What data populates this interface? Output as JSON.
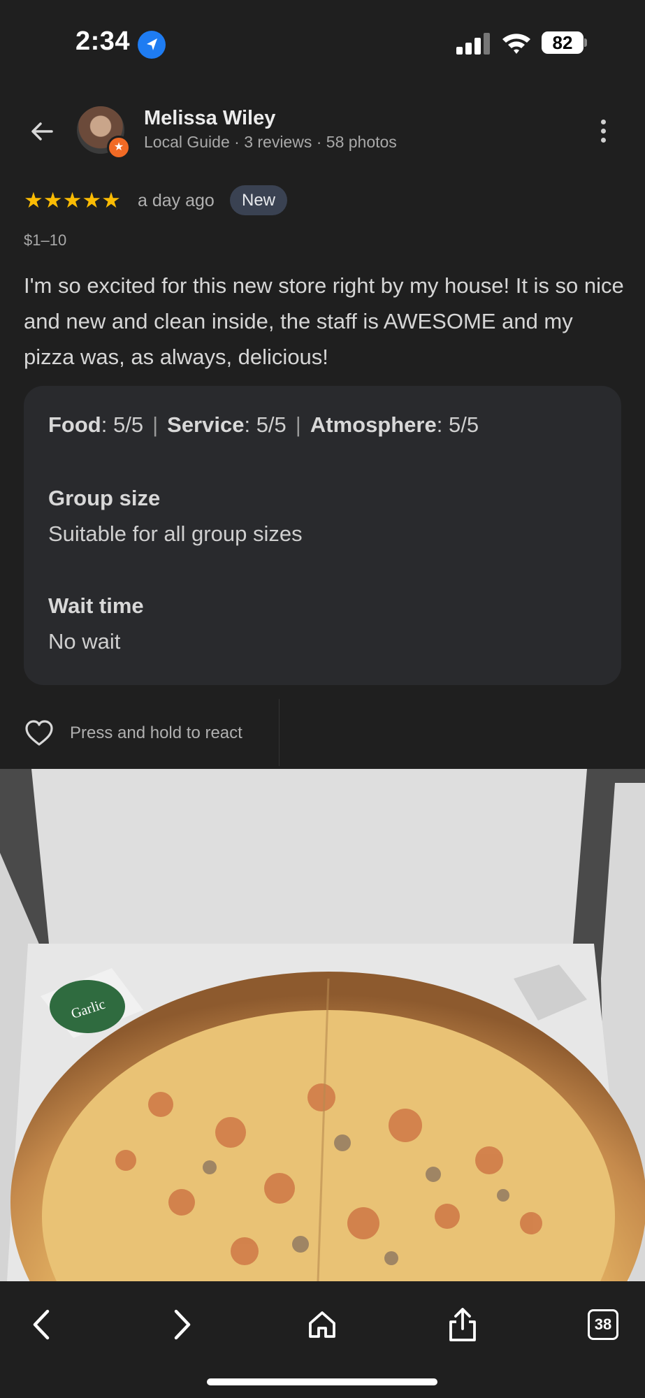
{
  "status_bar": {
    "time": "2:34",
    "battery": "82",
    "icons": [
      "location-arrow-icon",
      "cellular-signal-icon",
      "wifi-icon",
      "battery-icon"
    ]
  },
  "header": {
    "back_icon": "arrow-left-icon",
    "reviewer_name": "Melissa Wiley",
    "reviewer_meta": "Local Guide · 3 reviews · 58 photos",
    "badge_icon": "star-badge-icon",
    "more_icon": "more-vertical-icon"
  },
  "review": {
    "stars": "★★★★★",
    "rating": 5,
    "time": "a day ago",
    "badge": "New",
    "price_range": "$1–10",
    "text": "I'm so excited for this new store right by my house! It is so nice and new and clean inside, the staff is AWESOME and my pizza was, as always, delicious!"
  },
  "details": {
    "food_label": "Food",
    "food_value": ": 5/5",
    "service_label": "Service",
    "service_value": ": 5/5",
    "atmosphere_label": "Atmosphere",
    "atmosphere_value": ": 5/5",
    "separator": "|",
    "group_size_label": "Group size",
    "group_size_value": "Suitable for all group sizes",
    "wait_time_label": "Wait time",
    "wait_time_value": "No wait"
  },
  "react": {
    "icon": "heart-outline-icon",
    "label": "Press and hold to react"
  },
  "photo": {
    "description_icon": "review-photo",
    "sauce_label": "Garlic"
  },
  "toolbar": {
    "back_icon": "chevron-left-icon",
    "forward_icon": "chevron-right-icon",
    "home_icon": "home-icon",
    "share_icon": "share-icon",
    "tabs_count": "38"
  },
  "colors": {
    "background": "#1f1f1f",
    "card": "#292a2d",
    "star": "#fbbc04",
    "badge": "#3a4252",
    "guide_badge": "#f16a25",
    "location": "#1e7cf2"
  }
}
